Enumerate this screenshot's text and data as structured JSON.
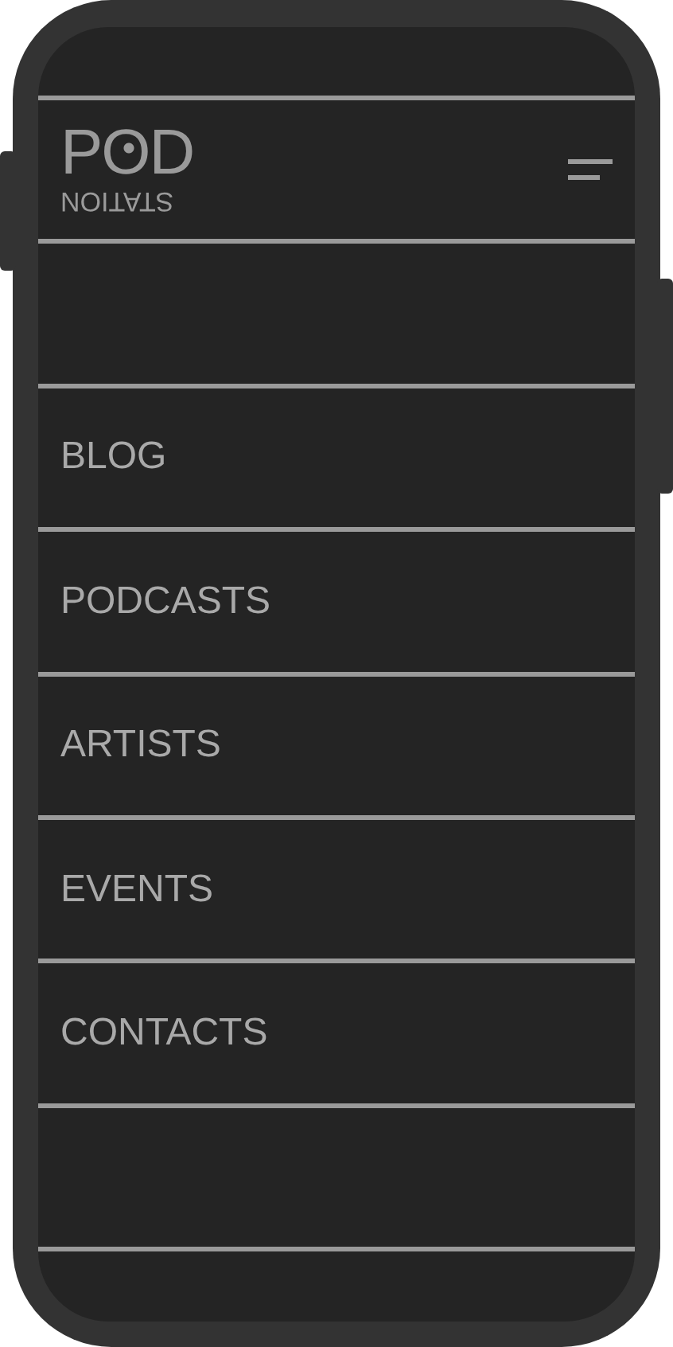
{
  "logo": {
    "title": "POD",
    "subtitle": "STATION"
  },
  "menu": [
    {
      "label": "BLOG"
    },
    {
      "label": "PODCASTS"
    },
    {
      "label": "ARTISTS"
    },
    {
      "label": "EVENTS"
    },
    {
      "label": "CONTACTS"
    }
  ]
}
